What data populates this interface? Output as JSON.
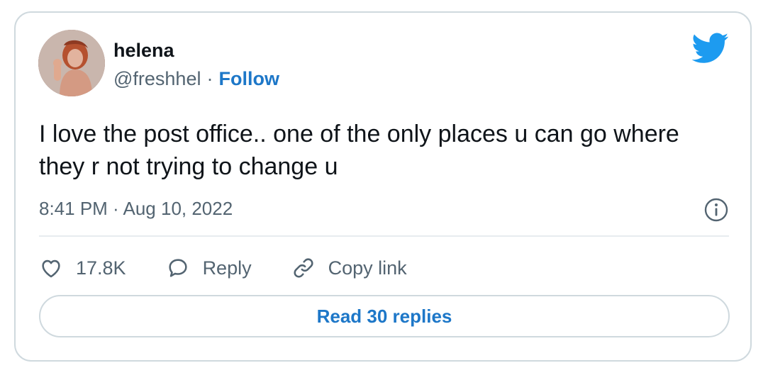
{
  "author": {
    "name": "helena",
    "handle": "@freshhel",
    "separator": "·",
    "follow_label": "Follow"
  },
  "tweet": {
    "text": "I love the post office.. one of the only places u can go where they r not trying to change u",
    "timestamp": "8:41 PM · Aug 10, 2022"
  },
  "actions": {
    "like_count": "17.8K",
    "reply_label": "Reply",
    "copy_link_label": "Copy link"
  },
  "footer": {
    "read_replies_label": "Read 30 replies"
  },
  "icons": {
    "brand": "twitter-bird-icon",
    "info": "info-icon",
    "like": "heart-icon",
    "reply": "speech-bubble-icon",
    "copy": "link-icon"
  },
  "colors": {
    "brand_blue": "#1d9bf0",
    "link_blue": "#1d77c8",
    "secondary_text": "#536471",
    "border": "#cfd9de"
  }
}
